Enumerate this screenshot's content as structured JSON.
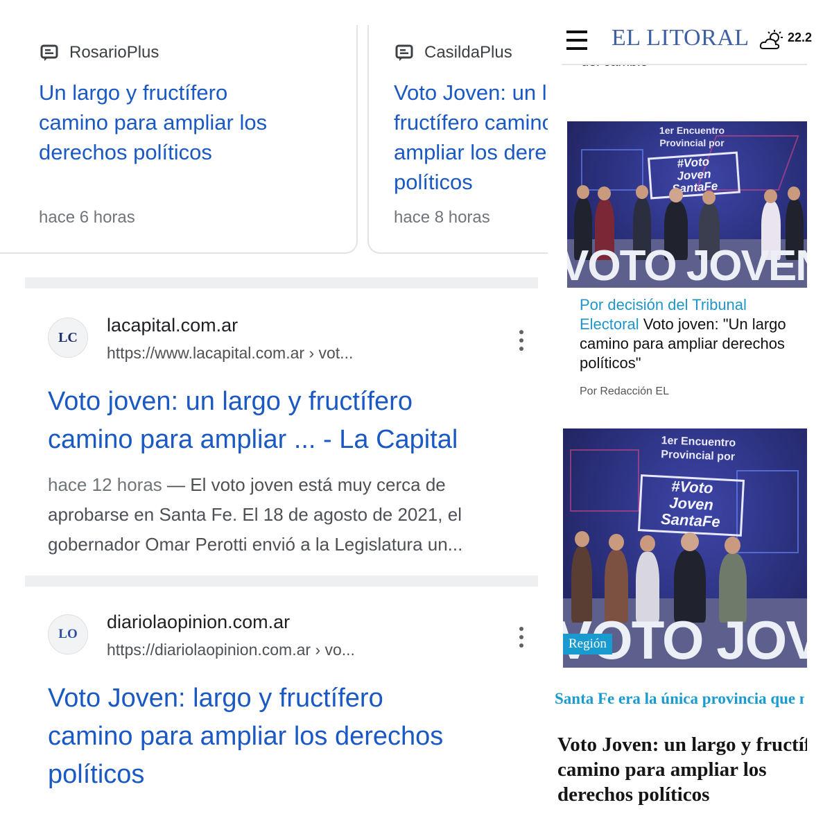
{
  "google": {
    "top_stories": [
      {
        "source": "RosarioPlus",
        "title_lines": [
          "Un largo y fructífero",
          "camino para ampliar los",
          "derechos políticos"
        ],
        "time": "hace 6 horas"
      },
      {
        "source": "CasildaPlus",
        "title_lines": [
          "Voto Joven: un largo y",
          "fructífero camino para",
          "ampliar los derechos",
          "políticos"
        ],
        "time": "hace 8 horas"
      }
    ],
    "results": [
      {
        "favicon_text": "LC",
        "site": "lacapital.com.ar",
        "url": "https://www.lacapital.com.ar › vot...",
        "title_lines": [
          "Voto joven: un largo y fructífero",
          "camino para ampliar ... - La Capital"
        ],
        "snippet_time": "hace 12 horas",
        "snippet_text": " — El voto joven está muy cerca de aprobarse en Santa Fe. El 18 de agosto de 2021, el gobernador Omar Perotti envió a la Legislatura un..."
      },
      {
        "favicon_text": "LO",
        "site": "diariolaopinion.com.ar",
        "url": "https://diariolaopinion.com.ar › vo...",
        "title_lines": [
          "Voto Joven: largo y fructífero",
          "camino para ampliar los derechos",
          "políticos"
        ]
      }
    ]
  },
  "litoral": {
    "brand": "EL LITORAL",
    "temperature": "22.2",
    "weather_icon": "partly-cloudy-icon",
    "prev_text": "del cambio",
    "photo_text": {
      "encuentro_line1": "1er Encuentro",
      "encuentro_line2": "Provincial por",
      "sign_line1": "#Voto",
      "sign_line2": "Joven",
      "sign_line3": "SantaFe",
      "stage_letters": "VOTO JOVEN"
    },
    "article1": {
      "kicker": "Por decisión del Tribunal Electoral",
      "headline": "Voto joven: \"Un largo camino para ampliar derechos políticos\"",
      "byline": "Por Redacción EL"
    },
    "article2": {
      "section": "Región",
      "lead": "Santa Fe era la única provincia que no lo tenía",
      "headline_lines": [
        "Voto Joven: un largo y fructífero",
        "camino para ampliar los",
        "derechos políticos"
      ]
    }
  }
}
